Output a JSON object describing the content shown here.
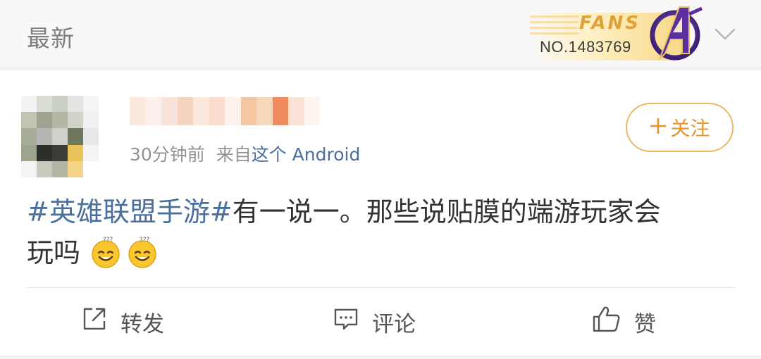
{
  "header": {
    "title": "最新",
    "fans_badge": {
      "label": "FANS",
      "number": "NO.1483769",
      "icon": "avengers-logo-icon"
    },
    "dropdown_icon": "chevron-down-icon"
  },
  "post": {
    "time": "30分钟前",
    "source_prefix": "来自",
    "source": "这个 Android",
    "follow_label": "关注",
    "follow_icon": "plus-icon",
    "topic": "#英雄联盟手游#",
    "text_line1": "有一说一。那些说贴膜的端游玩家会",
    "text_line2": "玩吗",
    "emojis": [
      "confused-smile-emoji",
      "confused-smile-emoji"
    ]
  },
  "actions": [
    {
      "icon": "share-icon",
      "label": "转发"
    },
    {
      "icon": "comment-icon",
      "label": "评论"
    },
    {
      "icon": "thumbs-up-icon",
      "label": "赞"
    }
  ],
  "colors": {
    "link": "#4a6f9c",
    "follow_accent": "#e8942c",
    "follow_border": "#f0b865",
    "badge_gold": "#e0a238"
  }
}
